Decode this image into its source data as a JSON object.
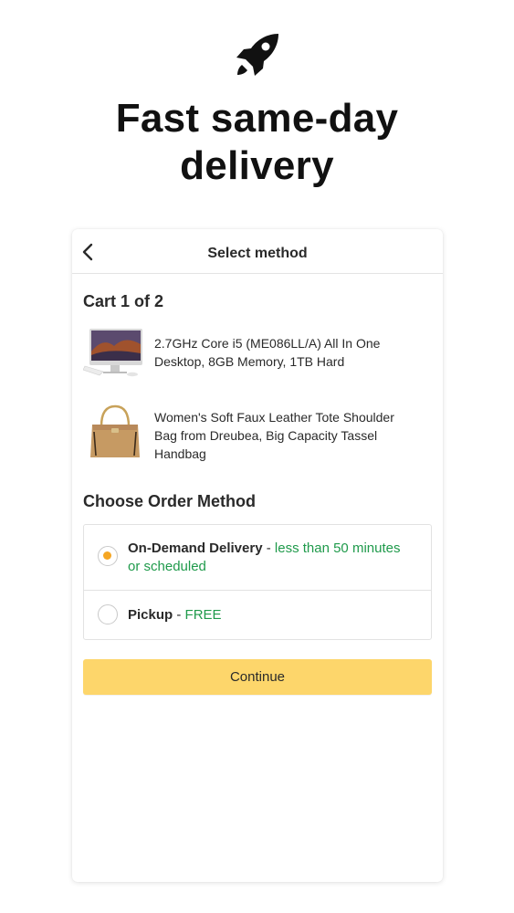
{
  "hero": {
    "icon": "rocket-icon",
    "title_line1": "Fast same-day",
    "title_line2": "delivery"
  },
  "screen": {
    "nav": {
      "back_icon": "chevron-left-icon",
      "title": "Select method"
    },
    "cart_heading": "Cart 1 of 2",
    "products": [
      {
        "image": "desktop-computer-image",
        "name": "2.7GHz Core i5 (ME086LL/A) All In One Desktop, 8GB Memory, 1TB Hard"
      },
      {
        "image": "tote-bag-image",
        "name": "Women's Soft Faux Leather Tote Shoulder Bag from Dreubea, Big Capacity Tassel Handbag"
      }
    ],
    "order_method_heading": "Choose Order Method",
    "methods": [
      {
        "label": "On-Demand Delivery",
        "separator": " - ",
        "detail": "less than 50 minutes or scheduled",
        "selected": true
      },
      {
        "label": "Pickup",
        "separator": " - ",
        "detail": "FREE",
        "selected": false
      }
    ],
    "continue_label": "Continue"
  },
  "colors": {
    "accent_green": "#1f9a4b",
    "radio_selected": "#f5a623",
    "button_yellow": "#fdd66b"
  }
}
